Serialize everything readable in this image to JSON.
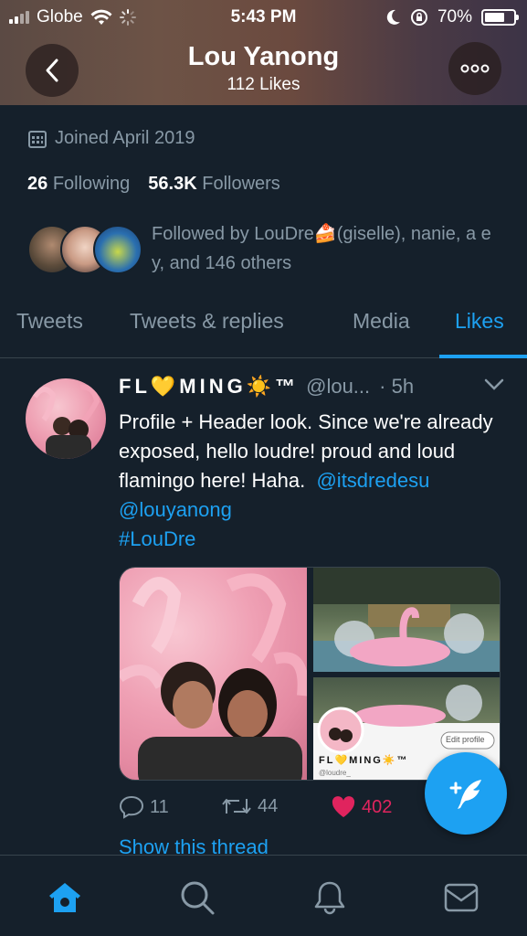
{
  "status_bar": {
    "carrier": "Globe",
    "time": "5:43 PM",
    "battery": "70%",
    "battery_level": 0.7
  },
  "header": {
    "title": "Lou Yanong",
    "subtitle": "112 Likes",
    "back_icon": "chevron-left-icon",
    "more_icon": "more-dots-icon"
  },
  "profile": {
    "joined": "Joined April 2019",
    "following_count": "26",
    "following_label": "Following",
    "followers_count": "56.3K",
    "followers_label": "Followers",
    "followed_by": "Followed by LouDre🍰(giselle), nanie, a e y, and 146 others"
  },
  "tabs": [
    {
      "label": "Tweets",
      "active": false
    },
    {
      "label": "Tweets & replies",
      "active": false
    },
    {
      "label": "Media",
      "active": false
    },
    {
      "label": "Likes",
      "active": true
    }
  ],
  "tweet": {
    "name": "FL💛MING☀️™",
    "handle": "@lou...",
    "time": "· 5h",
    "text_line1": "Profile + Header look. Since we're already exposed, hello loudre! proud and loud flamingo here! Haha.",
    "mention1": "@itsdredesu",
    "mention2": "@louyanong",
    "hashtag": "#LouDre",
    "replies": "11",
    "retweets": "44",
    "likes": "402",
    "show_thread": "Show this thread",
    "media_card": {
      "edit_profile": "Edit profile",
      "card_name": "FL💛MING☀️™",
      "card_handle": "@loudre_"
    }
  },
  "bottom_nav": [
    "home-icon",
    "search-icon",
    "notifications-icon",
    "messages-icon"
  ],
  "colors": {
    "background": "#15202b",
    "accent": "#1da1f2",
    "like": "#e0245e",
    "muted": "#8899a6"
  }
}
